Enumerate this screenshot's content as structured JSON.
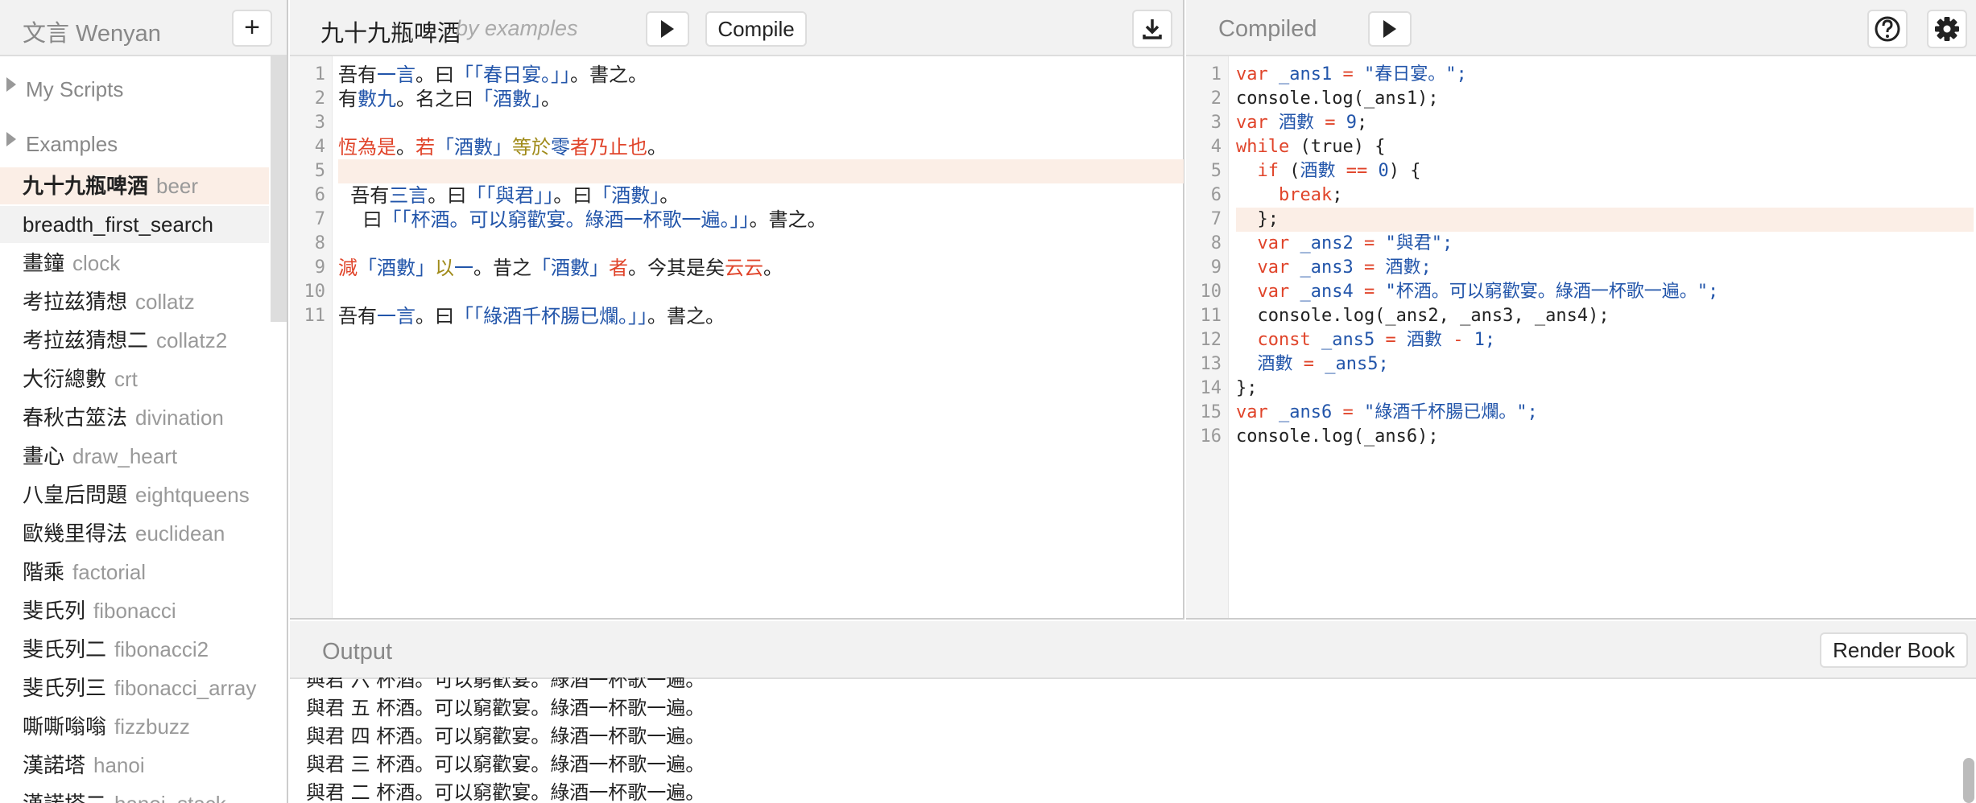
{
  "sidebar": {
    "app_title": "文言 Wenyan",
    "new_button": "+",
    "folders": [
      "My Scripts",
      "Examples"
    ],
    "examples": [
      {
        "zh": "九十九瓶啤酒",
        "en": "beer",
        "state": "active"
      },
      {
        "zh": "",
        "en": "breadth_first_search",
        "state": "hover"
      },
      {
        "zh": "畫鐘",
        "en": "clock"
      },
      {
        "zh": "考拉兹猜想",
        "en": "collatz"
      },
      {
        "zh": "考拉兹猜想二",
        "en": "collatz2"
      },
      {
        "zh": "大衍總數",
        "en": "crt"
      },
      {
        "zh": "春秋古筮法",
        "en": "divination"
      },
      {
        "zh": "畫心",
        "en": "draw_heart"
      },
      {
        "zh": "八皇后問題",
        "en": "eightqueens"
      },
      {
        "zh": "歐幾里得法",
        "en": "euclidean"
      },
      {
        "zh": "階乘",
        "en": "factorial"
      },
      {
        "zh": "斐氏列",
        "en": "fibonacci"
      },
      {
        "zh": "斐氏列二",
        "en": "fibonacci2"
      },
      {
        "zh": "斐氏列三",
        "en": "fibonacci_array"
      },
      {
        "zh": "嘶嘶嗡嗡",
        "en": "fizzbuzz"
      },
      {
        "zh": "漢諾塔",
        "en": "hanoi"
      },
      {
        "zh": "漢諾塔二",
        "en": "hanoi_stack"
      }
    ]
  },
  "editor": {
    "title": "九十九瓶啤酒",
    "author": "by examples",
    "compile_label": "Compile",
    "highlighted_line": 5,
    "lines": [
      [
        [
          "吾有",
          "#222"
        ],
        [
          "一言",
          "#2255aa"
        ],
        [
          "。曰",
          "#222"
        ],
        [
          "「「春日宴。」」",
          "#2255aa"
        ],
        [
          "。書之。",
          "#222"
        ]
      ],
      [
        [
          "有",
          "#222"
        ],
        [
          "數",
          "#2255aa"
        ],
        [
          "九",
          "#2255aa"
        ],
        [
          "。名之曰",
          "#222"
        ],
        [
          "「酒數」",
          "#2255aa"
        ],
        [
          "。",
          "#222"
        ]
      ],
      [],
      [
        [
          "恆為是",
          "#e0442a"
        ],
        [
          "。",
          "#222"
        ],
        [
          "若",
          "#e0442a"
        ],
        [
          "「酒數」",
          "#2255aa"
        ],
        [
          "等於",
          "#a08b1a"
        ],
        [
          "零",
          "#2255aa"
        ],
        [
          "者乃止也",
          "#e0442a"
        ],
        [
          "。",
          "#222"
        ]
      ],
      [],
      [
        [
          "  吾有",
          "#222"
        ],
        [
          "三言",
          "#2255aa"
        ],
        [
          "。曰",
          "#222"
        ],
        [
          "「「與君」」",
          "#2255aa"
        ],
        [
          "。曰",
          "#222"
        ],
        [
          "「酒數」",
          "#2255aa"
        ],
        [
          "。",
          "#222"
        ]
      ],
      [
        [
          "    曰",
          "#222"
        ],
        [
          "「「杯酒。可以窮歡宴。綠酒一杯歌一遍。」」",
          "#2255aa"
        ],
        [
          "。書之。",
          "#222"
        ]
      ],
      [],
      [
        [
          "減",
          "#e0442a"
        ],
        [
          "「酒數」",
          "#2255aa"
        ],
        [
          "以",
          "#a08b1a"
        ],
        [
          "一",
          "#2255aa"
        ],
        [
          "。昔之",
          "#222"
        ],
        [
          "「酒數」",
          "#2255aa"
        ],
        [
          "者",
          "#e0442a"
        ],
        [
          "。今其是矣",
          "#222"
        ],
        [
          "云云",
          "#e0442a"
        ],
        [
          "。",
          "#222"
        ]
      ],
      [],
      [
        [
          "吾有",
          "#222"
        ],
        [
          "一言",
          "#2255aa"
        ],
        [
          "。曰",
          "#222"
        ],
        [
          "「「綠酒千杯腸已爛。」」",
          "#2255aa"
        ],
        [
          "。書之。",
          "#222"
        ]
      ]
    ]
  },
  "compiled": {
    "title": "Compiled",
    "highlighted_line": 7,
    "lines": [
      [
        [
          "var",
          "#e0442a"
        ],
        [
          " _ans1 ",
          "#2255aa"
        ],
        [
          "=",
          "#e0442a"
        ],
        [
          " \"春日宴。\";",
          "#2255aa"
        ]
      ],
      [
        [
          "console.log(_ans1);",
          "#222"
        ]
      ],
      [
        [
          "var",
          "#e0442a"
        ],
        [
          " 酒數 ",
          "#2255aa"
        ],
        [
          "=",
          "#e0442a"
        ],
        [
          " 9",
          "#2255aa"
        ],
        [
          ";",
          "#222"
        ]
      ],
      [
        [
          "while",
          "#e0442a"
        ],
        [
          " (true) {",
          "#222"
        ]
      ],
      [
        [
          "  if",
          "#e0442a"
        ],
        [
          " (",
          "#222"
        ],
        [
          "酒數",
          "#2255aa"
        ],
        [
          " == ",
          "#e0442a"
        ],
        [
          "0",
          "#2255aa"
        ],
        [
          ") {",
          "#222"
        ]
      ],
      [
        [
          "    break",
          "#e0442a"
        ],
        [
          ";",
          "#222"
        ]
      ],
      [
        [
          "  };",
          "#222"
        ]
      ],
      [
        [
          "  var",
          "#e0442a"
        ],
        [
          " _ans2 ",
          "#2255aa"
        ],
        [
          "=",
          "#e0442a"
        ],
        [
          " \"與君\";",
          "#2255aa"
        ]
      ],
      [
        [
          "  var",
          "#e0442a"
        ],
        [
          " _ans3 ",
          "#2255aa"
        ],
        [
          "=",
          "#e0442a"
        ],
        [
          " 酒數;",
          "#2255aa"
        ]
      ],
      [
        [
          "  var",
          "#e0442a"
        ],
        [
          " _ans4 ",
          "#2255aa"
        ],
        [
          "=",
          "#e0442a"
        ],
        [
          " \"杯酒。可以窮歡宴。綠酒一杯歌一遍。\";",
          "#2255aa"
        ]
      ],
      [
        [
          "  console.log(_ans2, _ans3, _ans4);",
          "#222"
        ]
      ],
      [
        [
          "  const",
          "#e0442a"
        ],
        [
          " _ans5 ",
          "#2255aa"
        ],
        [
          "=",
          "#e0442a"
        ],
        [
          " 酒數 ",
          "#2255aa"
        ],
        [
          "-",
          "#e0442a"
        ],
        [
          " 1;",
          "#2255aa"
        ]
      ],
      [
        [
          "  酒數 ",
          "#2255aa"
        ],
        [
          "=",
          "#e0442a"
        ],
        [
          " _ans5;",
          "#2255aa"
        ]
      ],
      [
        [
          "};",
          "#222"
        ]
      ],
      [
        [
          "var",
          "#e0442a"
        ],
        [
          " _ans6 ",
          "#2255aa"
        ],
        [
          "=",
          "#e0442a"
        ],
        [
          " \"綠酒千杯腸已爛。\";",
          "#2255aa"
        ]
      ],
      [
        [
          "console.log(_ans6);",
          "#222"
        ]
      ]
    ]
  },
  "output": {
    "title": "Output",
    "render_label": "Render Book",
    "lines": [
      "與君 六 杯酒。可以窮歡宴。綠酒一杯歌一遍。",
      "與君 五 杯酒。可以窮歡宴。綠酒一杯歌一遍。",
      "與君 四 杯酒。可以窮歡宴。綠酒一杯歌一遍。",
      "與君 三 杯酒。可以窮歡宴。綠酒一杯歌一遍。",
      "與君 二 杯酒。可以窮歡宴。綠酒一杯歌一遍。"
    ]
  },
  "icons": {
    "run_editor": "play-icon",
    "download": "download-icon",
    "run_compiled": "play-icon",
    "help": "help-icon",
    "settings": "gear-icon"
  }
}
